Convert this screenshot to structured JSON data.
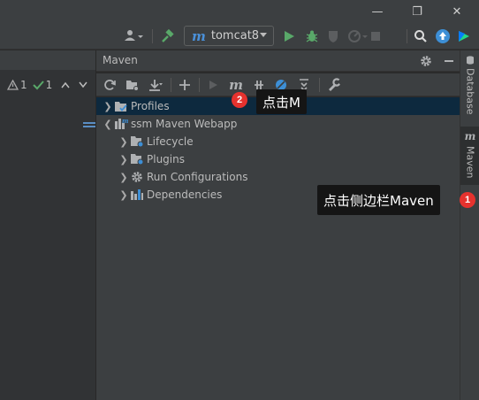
{
  "window": {
    "minimize_glyph": "—",
    "restore_glyph": "❐",
    "close_glyph": "✕"
  },
  "toolbar": {
    "run_config": {
      "icon": "m",
      "label": "tomcat8"
    }
  },
  "inspections": {
    "warnings": "1",
    "passed": "1"
  },
  "maven": {
    "title": "Maven",
    "tree": [
      {
        "label": "Profiles"
      },
      {
        "label": "ssm Maven Webapp"
      },
      {
        "label": "Lifecycle"
      },
      {
        "label": "Plugins"
      },
      {
        "label": "Run Configurations"
      },
      {
        "label": "Dependencies"
      }
    ],
    "m_tool_glyph": "m"
  },
  "side_tabs": {
    "database": "Database",
    "maven": "Maven",
    "maven_icon": "m"
  },
  "annotations": {
    "step1": {
      "number": "1",
      "text": "点击侧边栏Maven"
    },
    "step2": {
      "number": "2",
      "text": "点击M"
    }
  },
  "colors": {
    "accent": "#4a90d9",
    "badge": "#e6322e",
    "selection": "#0d293e",
    "run_green": "#59a869"
  }
}
